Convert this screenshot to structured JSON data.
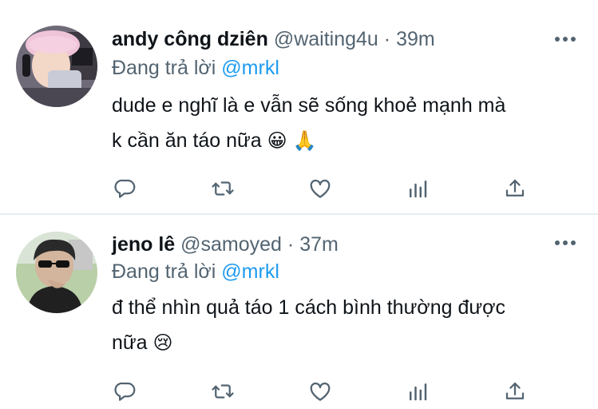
{
  "tweets": [
    {
      "display_name": "andy công dziên",
      "handle": "@waiting4u",
      "separator": "·",
      "time": "39m",
      "reply_prefix": "Đang trả lời",
      "reply_to": "@mrkl",
      "text_lines": [
        "dude e nghĩ là e vẫn sẽ sống khoẻ mạnh mà",
        "k cần ăn táo nữa"
      ],
      "emojis": [
        "😀",
        "🙏"
      ]
    },
    {
      "display_name": "jeno lê",
      "handle": "@samoyed",
      "separator": "·",
      "time": "37m",
      "reply_prefix": "Đang trả lời",
      "reply_to": "@mrkl",
      "text_lines": [
        "đ thể nhìn quả táo 1 cách bình thường được",
        "nữa"
      ],
      "emojis": [
        "😢"
      ]
    }
  ],
  "action_icons": [
    "reply-icon",
    "retweet-icon",
    "like-icon",
    "analytics-icon",
    "share-icon"
  ],
  "colors": {
    "text": "#0f1419",
    "secondary": "#536471",
    "mention": "#1d9bf0",
    "divider": "#e6ecf0"
  }
}
